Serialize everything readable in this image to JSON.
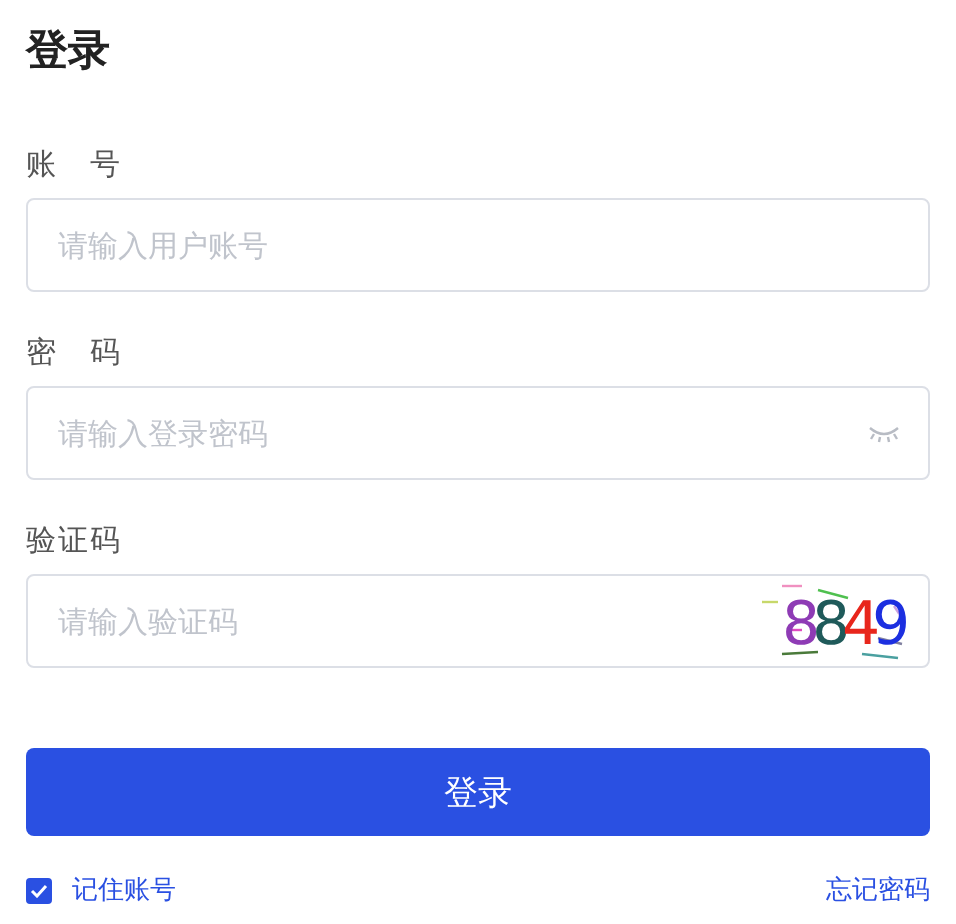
{
  "title": "登录",
  "fields": [
    {
      "kind": "text",
      "label": "账　号",
      "placeholder": "请输入用户账号"
    },
    {
      "kind": "password",
      "label": "密　码",
      "placeholder": "请输入登录密码"
    },
    {
      "kind": "captcha",
      "label": "验证码",
      "placeholder": "请输入验证码",
      "captcha": [
        {
          "text": "8",
          "color": "#8e3bb5"
        },
        {
          "text": "8",
          "color": "#1f5a5a"
        },
        {
          "text": "4",
          "color": "#e8261c"
        },
        {
          "text": "9",
          "color": "#1c2fe0"
        }
      ]
    }
  ],
  "submit": "登录",
  "remember": {
    "label": "记住账号",
    "checked": true
  },
  "forgot": "忘记密码"
}
